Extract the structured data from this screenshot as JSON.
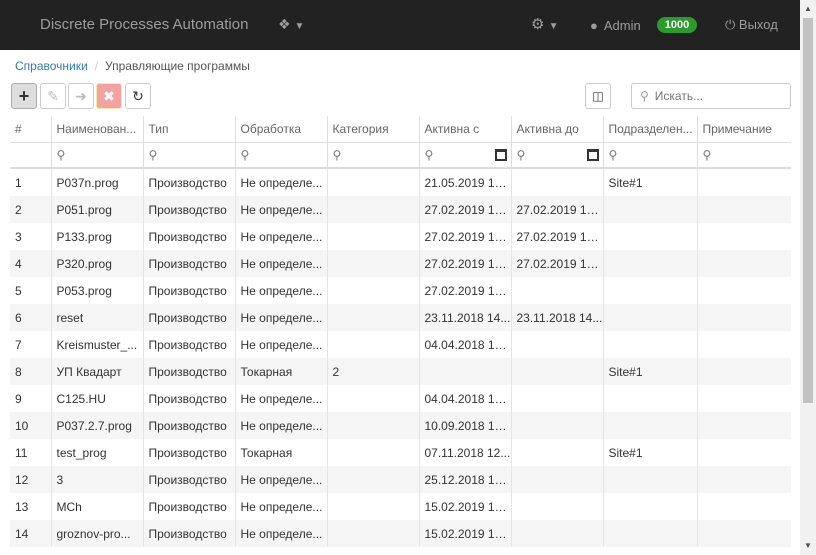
{
  "app": {
    "title": "Discrete Processes Automation"
  },
  "nav": {
    "user_name": "Admin",
    "balance": "1000",
    "logout_label": "Выход"
  },
  "breadcrumb": {
    "root": "Справочники",
    "current": "Управляющие программы"
  },
  "search": {
    "placeholder": "Искать..."
  },
  "table": {
    "columns": [
      "#",
      "Наименован...",
      "Тип",
      "Обработка",
      "Категория",
      "Активна с",
      "Активна до",
      "Подразделен...",
      "Примечание"
    ],
    "rows": [
      [
        "1",
        "P037n.prog",
        "Производство",
        "Не определе...",
        "",
        "21.05.2019 16...",
        "",
        "Site#1",
        ""
      ],
      [
        "2",
        "P051.prog",
        "Производство",
        "Не определе...",
        "",
        "27.02.2019 19...",
        "27.02.2019 19...",
        "",
        ""
      ],
      [
        "3",
        "P133.prog",
        "Производство",
        "Не определе...",
        "",
        "27.02.2019 19...",
        "27.02.2019 19...",
        "",
        ""
      ],
      [
        "4",
        "P320.prog",
        "Производство",
        "Не определе...",
        "",
        "27.02.2019 19...",
        "27.02.2019 19...",
        "",
        ""
      ],
      [
        "5",
        "P053.prog",
        "Производство",
        "Не определе...",
        "",
        "27.02.2019 19...",
        "",
        "",
        ""
      ],
      [
        "6",
        "reset",
        "Производство",
        "Не определе...",
        "",
        "23.11.2018 14...",
        "23.11.2018 14...",
        "",
        ""
      ],
      [
        "7",
        "Kreismuster_...",
        "Производство",
        "Не определе...",
        "",
        "04.04.2018 10...",
        "",
        "",
        ""
      ],
      [
        "8",
        "УП Квадарт",
        "Производство",
        "Токарная",
        "2",
        "",
        "",
        "Site#1",
        ""
      ],
      [
        "9",
        "C125.HU",
        "Производство",
        "Не определе...",
        "",
        "04.04.2018 10...",
        "",
        "",
        ""
      ],
      [
        "10",
        "P037.2.7.prog",
        "Производство",
        "Не определе...",
        "",
        "10.09.2018 15...",
        "",
        "",
        ""
      ],
      [
        "11",
        "test_prog",
        "Производство",
        "Токарная",
        "",
        "07.11.2018 12...",
        "",
        "Site#1",
        ""
      ],
      [
        "12",
        "3",
        "Производство",
        "Не определе...",
        "",
        "25.12.2018 15...",
        "",
        "",
        ""
      ],
      [
        "13",
        "MCh",
        "Производство",
        "Не определе...",
        "",
        "15.02.2019 13...",
        "",
        "",
        ""
      ],
      [
        "14",
        "groznov-pro...",
        "Производство",
        "Не определе...",
        "",
        "15.02.2019 14...",
        "",
        "",
        ""
      ]
    ]
  },
  "colors": {
    "navbar": "#222222",
    "badge": "#2c9a2c",
    "link": "#337ab7",
    "delete": "#f2a2a0"
  }
}
